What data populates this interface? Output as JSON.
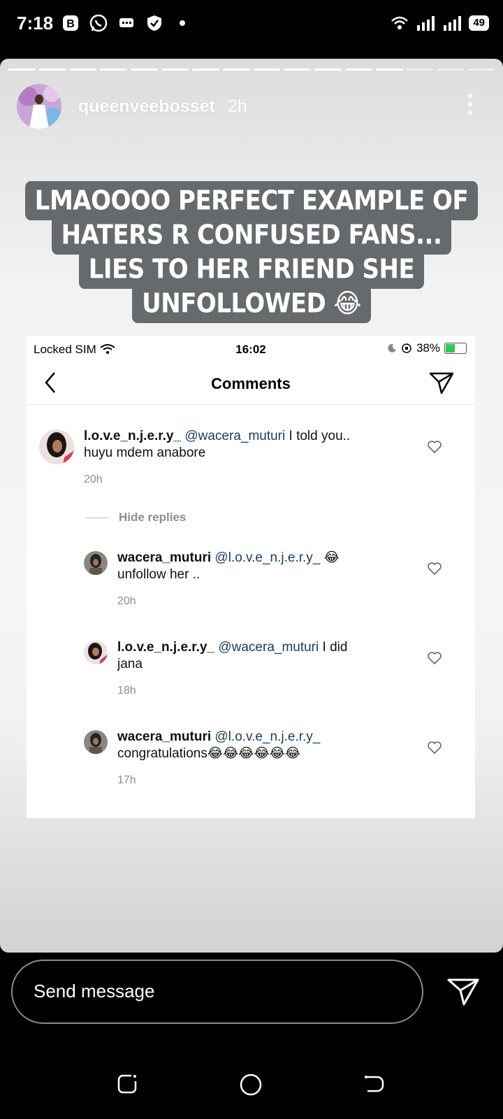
{
  "status_bar": {
    "time": "7:18",
    "battery": "49"
  },
  "story": {
    "username": "queenveebosset",
    "age": "2h",
    "caption_lines": [
      "LMAOOOO PERFECT EXAMPLE OF",
      "HATERS R CONFUSED FANS...",
      "LIES TO HER FRIEND SHE",
      "UNFOLLOWED 😂"
    ],
    "progress_segments_total": 16,
    "progress_segments_done": 13
  },
  "embedded_screenshot": {
    "carrier": "Locked SIM",
    "time": "16:02",
    "battery": "38%",
    "title": "Comments",
    "comments": [
      {
        "user": "l.o.v.e_n.j.e.r.y_",
        "mention": "@wacera_muturi",
        "text_line1": " I told you..",
        "text_line2": "huyu mdem anabore",
        "time": "20h"
      },
      {
        "user": "wacera_muturi",
        "mention": "@l.o.v.e_n.j.e.r.y_",
        "text_line1": " 😂",
        "text_line2": "unfollow her ..",
        "time": "20h"
      },
      {
        "user": "l.o.v.e_n.j.e.r.y_",
        "mention": "@wacera_muturi",
        "text_line1": " I did",
        "text_line2": "jana",
        "time": "18h"
      },
      {
        "user": "wacera_muturi",
        "mention": "@l.o.v.e_n.j.e.r.y_",
        "text_line1": "",
        "text_line2": "congratulations😂😂😂😂😂😂",
        "time": "17h"
      }
    ],
    "hide_replies": "Hide replies"
  },
  "reply": {
    "placeholder": "Send message"
  },
  "colors": {
    "mention": "#1c3d63",
    "caption_bg": "#666a6c",
    "meta": "#8e8e8e"
  }
}
